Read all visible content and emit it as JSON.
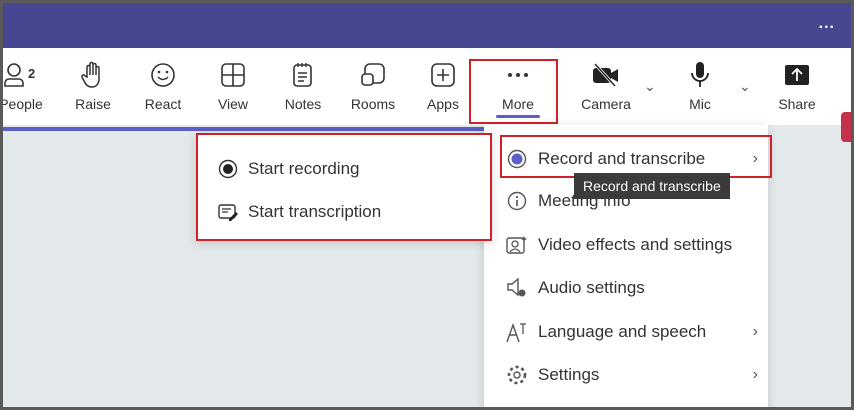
{
  "topbar": {
    "more_label": "..."
  },
  "toolbar": {
    "people": {
      "label": "People",
      "count": "2"
    },
    "raise": "Raise",
    "react": "React",
    "view": "View",
    "notes": "Notes",
    "rooms": "Rooms",
    "apps": "Apps",
    "more": "More",
    "camera": "Camera",
    "mic": "Mic",
    "share": "Share"
  },
  "menu": {
    "items": [
      {
        "label": "Record and transcribe"
      },
      {
        "label": "Meeting info"
      },
      {
        "label": "Video effects and settings"
      },
      {
        "label": "Audio settings"
      },
      {
        "label": "Language and speech"
      },
      {
        "label": "Settings"
      }
    ]
  },
  "submenu": {
    "start_recording": "Start recording",
    "start_transcription": "Start transcription"
  },
  "tooltip": "Record and transcribe",
  "colors": {
    "brand": "#464790",
    "accent": "#5b5fc7",
    "highlight": "#d0202a"
  }
}
